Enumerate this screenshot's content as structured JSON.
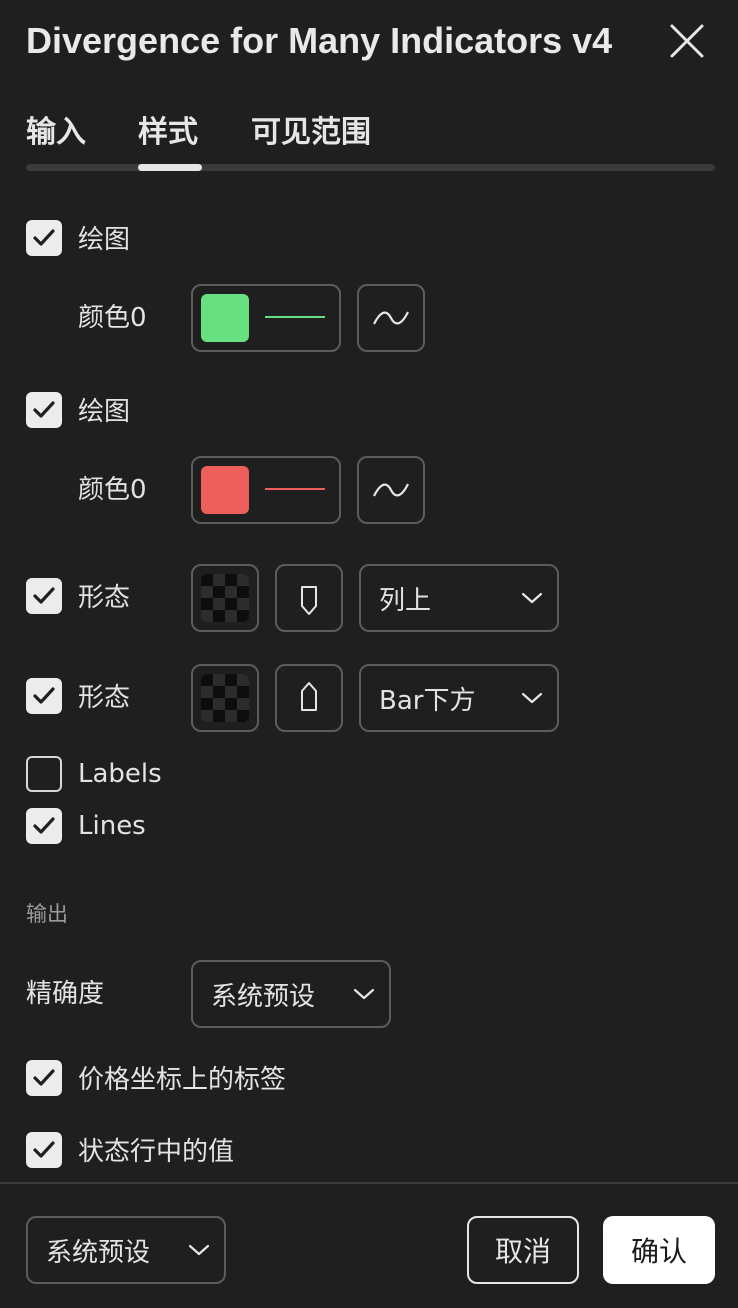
{
  "dialog": {
    "title": "Divergence for Many Indicators v4"
  },
  "tabs": [
    {
      "label": "输入"
    },
    {
      "label": "样式",
      "active": true
    },
    {
      "label": "可见范围"
    }
  ],
  "plots": [
    {
      "checked": true,
      "label": "绘图",
      "color_label": "颜色0",
      "color": "#68e081",
      "line_style_icon": "wave-icon"
    },
    {
      "checked": true,
      "label": "绘图",
      "color_label": "颜色0",
      "color": "#ec5f5a",
      "line_style_icon": "wave-icon"
    }
  ],
  "shapes": [
    {
      "checked": true,
      "label": "形态",
      "shape_icon": "pointer-down-icon",
      "location": "列上"
    },
    {
      "checked": true,
      "label": "形态",
      "shape_icon": "pointer-up-icon",
      "location": "Bar下方"
    }
  ],
  "toggles": [
    {
      "checked": false,
      "label": "Labels"
    },
    {
      "checked": true,
      "label": "Lines"
    }
  ],
  "output": {
    "section_title": "输出",
    "precision_label": "精确度",
    "precision_value": "系统预设",
    "price_scale_labels": {
      "checked": true,
      "label": "价格坐标上的标签"
    },
    "status_line_values": {
      "checked": true,
      "label": "状态行中的值"
    }
  },
  "footer": {
    "defaults_value": "系统预设",
    "cancel_label": "取消",
    "ok_label": "确认"
  }
}
